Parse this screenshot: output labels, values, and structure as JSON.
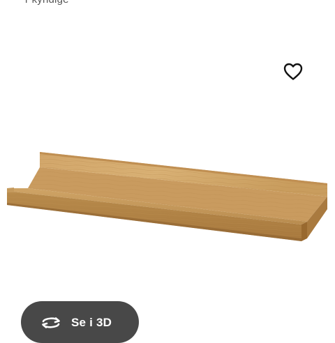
{
  "header": {
    "partial_text": "r kyndige"
  },
  "favorite": {
    "icon": "heart-icon"
  },
  "product": {
    "image": "wooden-picture-ledge-shelf"
  },
  "view_3d": {
    "label": "Se i 3D",
    "icon": "rotate-3d-icon",
    "bg_color": "#484848"
  },
  "colors": {
    "background": "#ffffff",
    "wood_light": "#d3a96a",
    "wood_dark": "#9a6e34"
  }
}
